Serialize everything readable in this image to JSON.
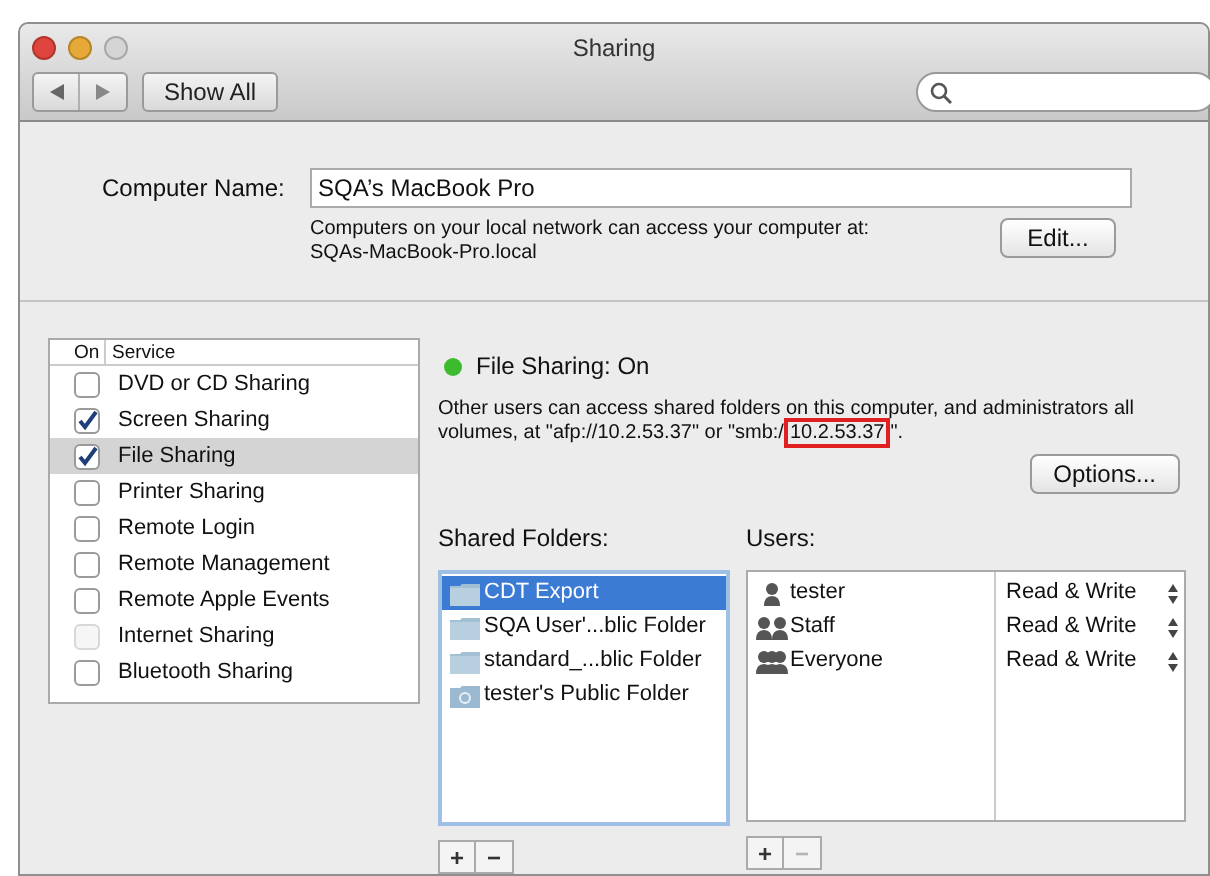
{
  "window": {
    "title": "Sharing"
  },
  "toolbar": {
    "show_all": "Show All"
  },
  "computer_name": {
    "label": "Computer Name:",
    "value": "SQA’s MacBook Pro",
    "hint_line1": "Computers on your local network can access your computer at:",
    "hint_line2": "SQAs-MacBook-Pro.local",
    "edit_button": "Edit..."
  },
  "services": {
    "columns": [
      "On",
      "Service"
    ],
    "rows": [
      {
        "name": "DVD or CD Sharing",
        "checked": false,
        "disabled": false,
        "selected": false
      },
      {
        "name": "Screen Sharing",
        "checked": true,
        "disabled": false,
        "selected": false
      },
      {
        "name": "File Sharing",
        "checked": true,
        "disabled": false,
        "selected": true
      },
      {
        "name": "Printer Sharing",
        "checked": false,
        "disabled": false,
        "selected": false
      },
      {
        "name": "Remote Login",
        "checked": false,
        "disabled": false,
        "selected": false
      },
      {
        "name": "Remote Management",
        "checked": false,
        "disabled": false,
        "selected": false
      },
      {
        "name": "Remote Apple Events",
        "checked": false,
        "disabled": false,
        "selected": false
      },
      {
        "name": "Internet Sharing",
        "checked": false,
        "disabled": true,
        "selected": false
      },
      {
        "name": "Bluetooth Sharing",
        "checked": false,
        "disabled": false,
        "selected": false
      }
    ]
  },
  "status": {
    "title": "File Sharing: On",
    "on": true,
    "description_start": "Other users can access shared folders on this computer, and administrators all volumes, at \"afp://10.2.53.37\" or \"smb:/",
    "highlighted": "10.2.53.37",
    "description_end": "\".",
    "options_button": "Options..."
  },
  "shared_folders": {
    "label": "Shared Folders:",
    "items": [
      {
        "name": "CDT Export",
        "kind": "folder",
        "selected": true
      },
      {
        "name": "SQA User'...blic Folder",
        "kind": "folder",
        "selected": false
      },
      {
        "name": "standard_...blic Folder",
        "kind": "folder",
        "selected": false
      },
      {
        "name": "tester's Public Folder",
        "kind": "public",
        "selected": false
      }
    ],
    "add": "+",
    "remove": "−",
    "remove_disabled": false
  },
  "users": {
    "label": "Users:",
    "items": [
      {
        "name": "tester",
        "kind": "user",
        "permission": "Read & Write"
      },
      {
        "name": "Staff",
        "kind": "group",
        "permission": "Read & Write"
      },
      {
        "name": "Everyone",
        "kind": "everyone",
        "permission": "Read & Write"
      }
    ],
    "add": "+",
    "remove": "−",
    "remove_disabled": true
  }
}
